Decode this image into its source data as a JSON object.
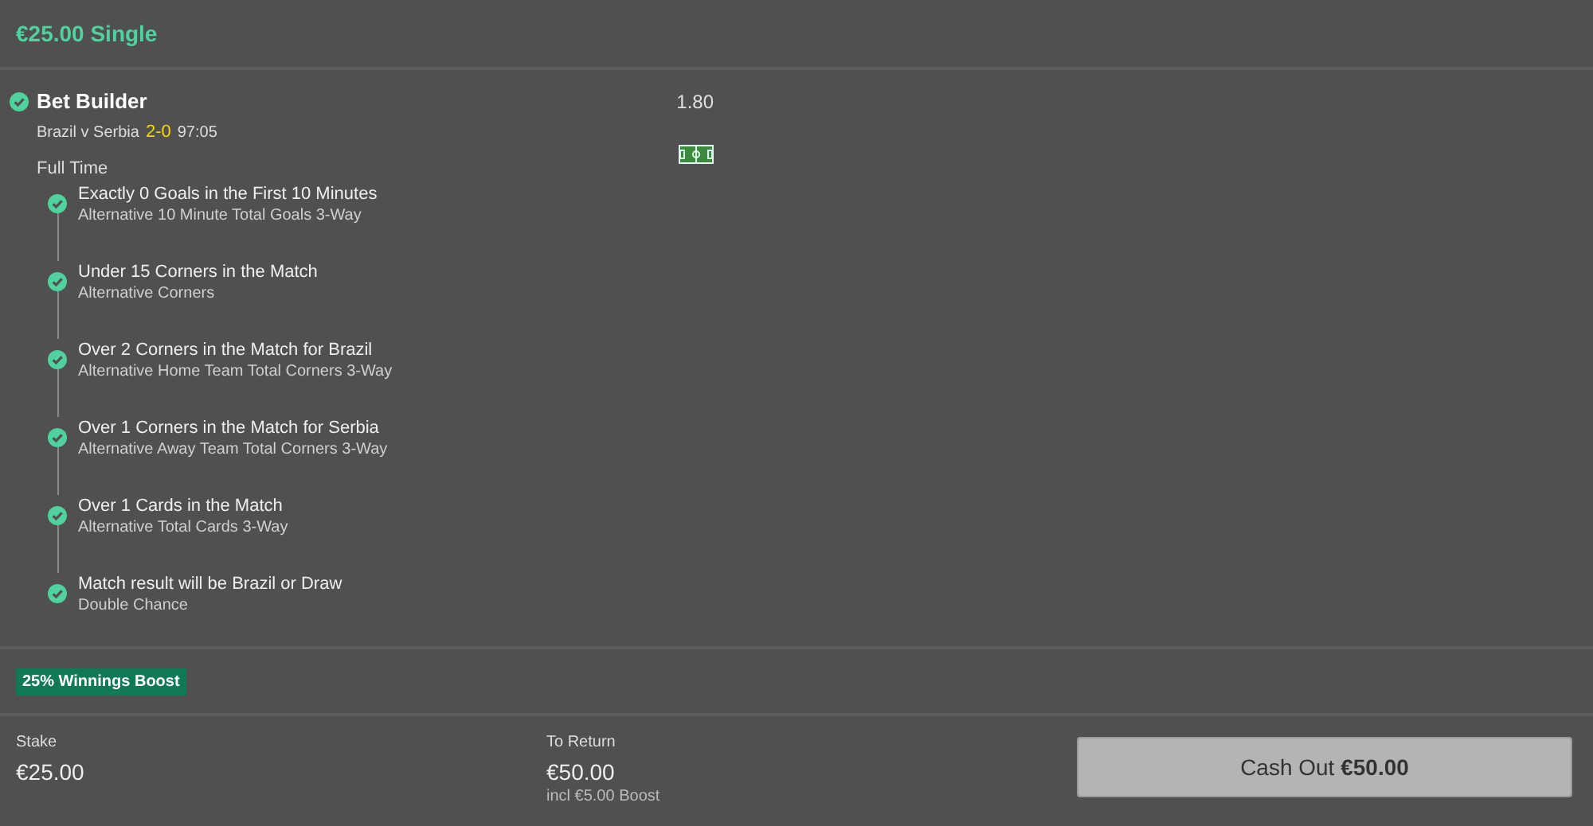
{
  "header": {
    "title": "€25.00 Single"
  },
  "bet": {
    "title": "Bet Builder",
    "settled": true,
    "odds": "1.80",
    "event": "Brazil v Serbia",
    "score": "2-0",
    "clock": "97:05",
    "period": "Full Time",
    "selections": [
      {
        "name": "Exactly 0 Goals in the First 10 Minutes",
        "market": "Alternative 10 Minute Total Goals 3-Way",
        "won": true
      },
      {
        "name": "Under 15 Corners in the Match",
        "market": "Alternative Corners",
        "won": true
      },
      {
        "name": "Over 2 Corners in the Match for Brazil",
        "market": "Alternative Home Team Total Corners 3-Way",
        "won": true
      },
      {
        "name": "Over 1 Corners in the Match for Serbia",
        "market": "Alternative Away Team Total Corners 3-Way",
        "won": true
      },
      {
        "name": "Over 1 Cards in the Match",
        "market": "Alternative Total Cards 3-Way",
        "won": true
      },
      {
        "name": "Match result will be Brazil or Draw",
        "market": "Double Chance",
        "won": true
      }
    ]
  },
  "boost": {
    "label": "25% Winnings Boost"
  },
  "footer": {
    "stake_label": "Stake",
    "stake": "€25.00",
    "return_label": "To Return",
    "return": "€50.00",
    "boost_note": "incl €5.00 Boost",
    "cash_out": {
      "label": "Cash Out",
      "amount": "€50.00"
    }
  }
}
